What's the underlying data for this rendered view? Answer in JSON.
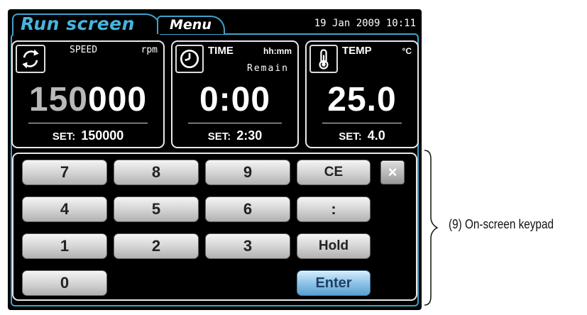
{
  "header": {
    "run_tab": "Run screen",
    "menu_tab": "Menu",
    "datetime": "19 Jan 2009 10:11"
  },
  "speed": {
    "icon": "rotation-icon",
    "label": "SPEED",
    "unit": "rpm",
    "value_dim": "150",
    "value_bright": "000",
    "set_label": "SET:",
    "set_value": "150000"
  },
  "time": {
    "icon": "clock-icon",
    "label": "TIME",
    "unit": "hh:mm",
    "sub_label": "Remain",
    "value": "0:00",
    "set_label": "SET:",
    "set_value": "2:30"
  },
  "temp": {
    "icon": "thermometer-icon",
    "label": "TEMP",
    "unit": "°C",
    "value": "25.0",
    "set_label": "SET:",
    "set_value": "4.0"
  },
  "keypad": {
    "k7": "7",
    "k8": "8",
    "k9": "9",
    "ce": "CE",
    "k4": "4",
    "k5": "5",
    "k6": "6",
    "colon": ":",
    "k1": "1",
    "k2": "2",
    "k3": "3",
    "hold": "Hold",
    "k0": "0",
    "enter": "Enter",
    "close": "×"
  },
  "annotation": "(9) On-screen keypad",
  "colors": {
    "accent": "#3fa2c9",
    "background": "#000000",
    "enter": "#8ec4e8"
  }
}
